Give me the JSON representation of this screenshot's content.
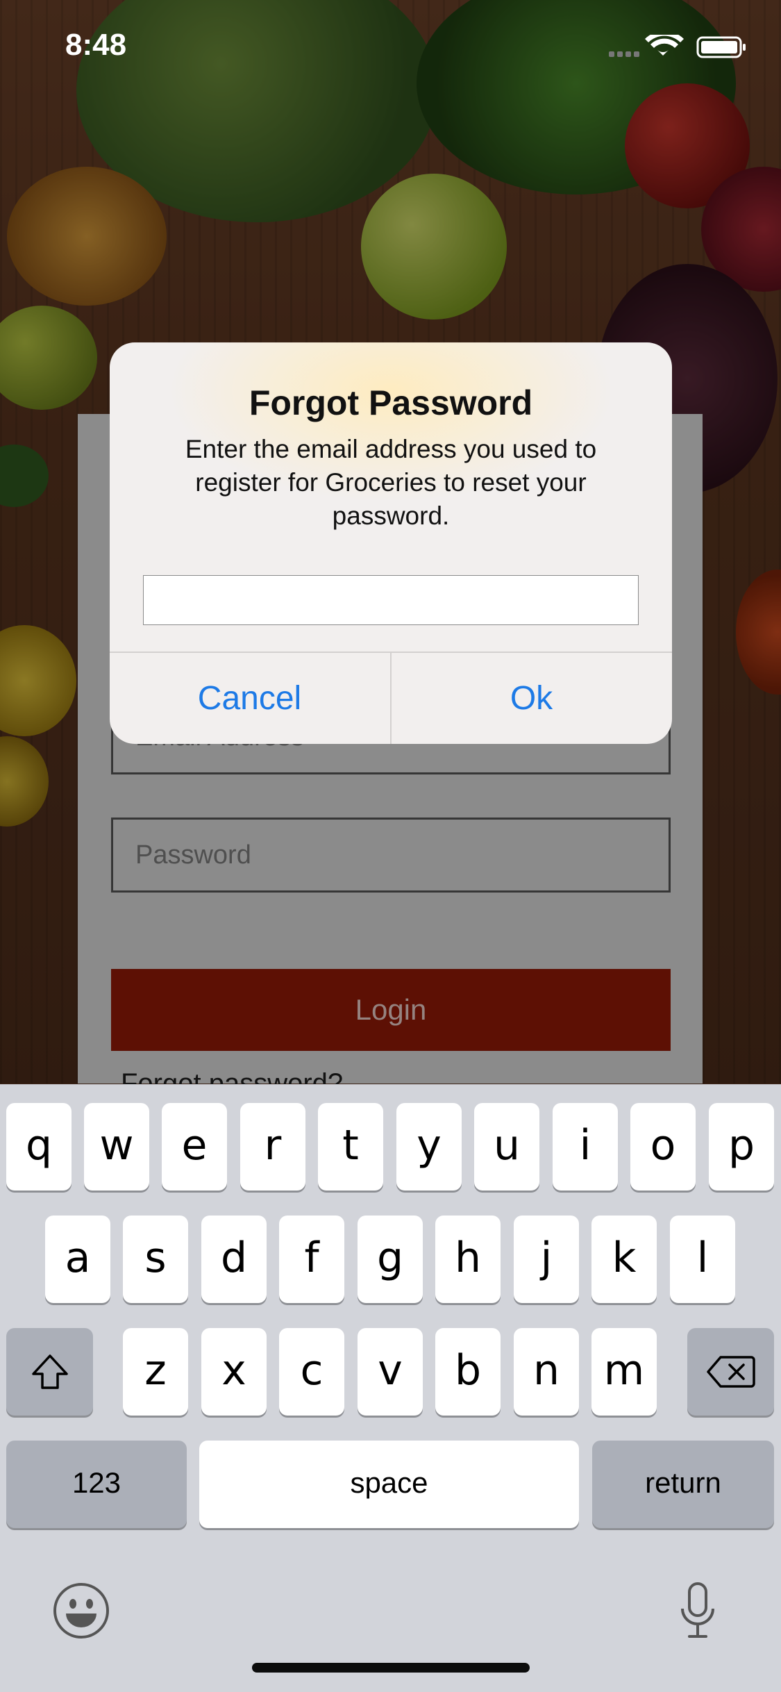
{
  "status_bar": {
    "time": "8:48"
  },
  "login_form": {
    "email_placeholder": "Email Address",
    "password_placeholder": "Password",
    "login_label": "Login",
    "forgot_label": "Forgot password?"
  },
  "alert": {
    "title": "Forgot Password",
    "message": "Enter the email address you used to register for Groceries to reset your password.",
    "input_value": "",
    "cancel_label": "Cancel",
    "ok_label": "Ok",
    "button_color": "#1d7ae6"
  },
  "keyboard": {
    "row1": [
      "q",
      "w",
      "e",
      "r",
      "t",
      "y",
      "u",
      "i",
      "o",
      "p"
    ],
    "row2": [
      "a",
      "s",
      "d",
      "f",
      "g",
      "h",
      "j",
      "k",
      "l"
    ],
    "row3": [
      "z",
      "x",
      "c",
      "v",
      "b",
      "n",
      "m"
    ],
    "numbers_label": "123",
    "space_label": "space",
    "return_label": "return"
  },
  "icons": {
    "shift": "shift-icon",
    "delete": "delete-icon",
    "emoji": "emoji-icon",
    "microphone": "microphone-icon",
    "wifi": "wifi-icon",
    "battery": "battery-icon",
    "signal": "signal-icon"
  },
  "colors": {
    "login_button": "#7e1606",
    "keyboard_background": "#d2d4da"
  }
}
